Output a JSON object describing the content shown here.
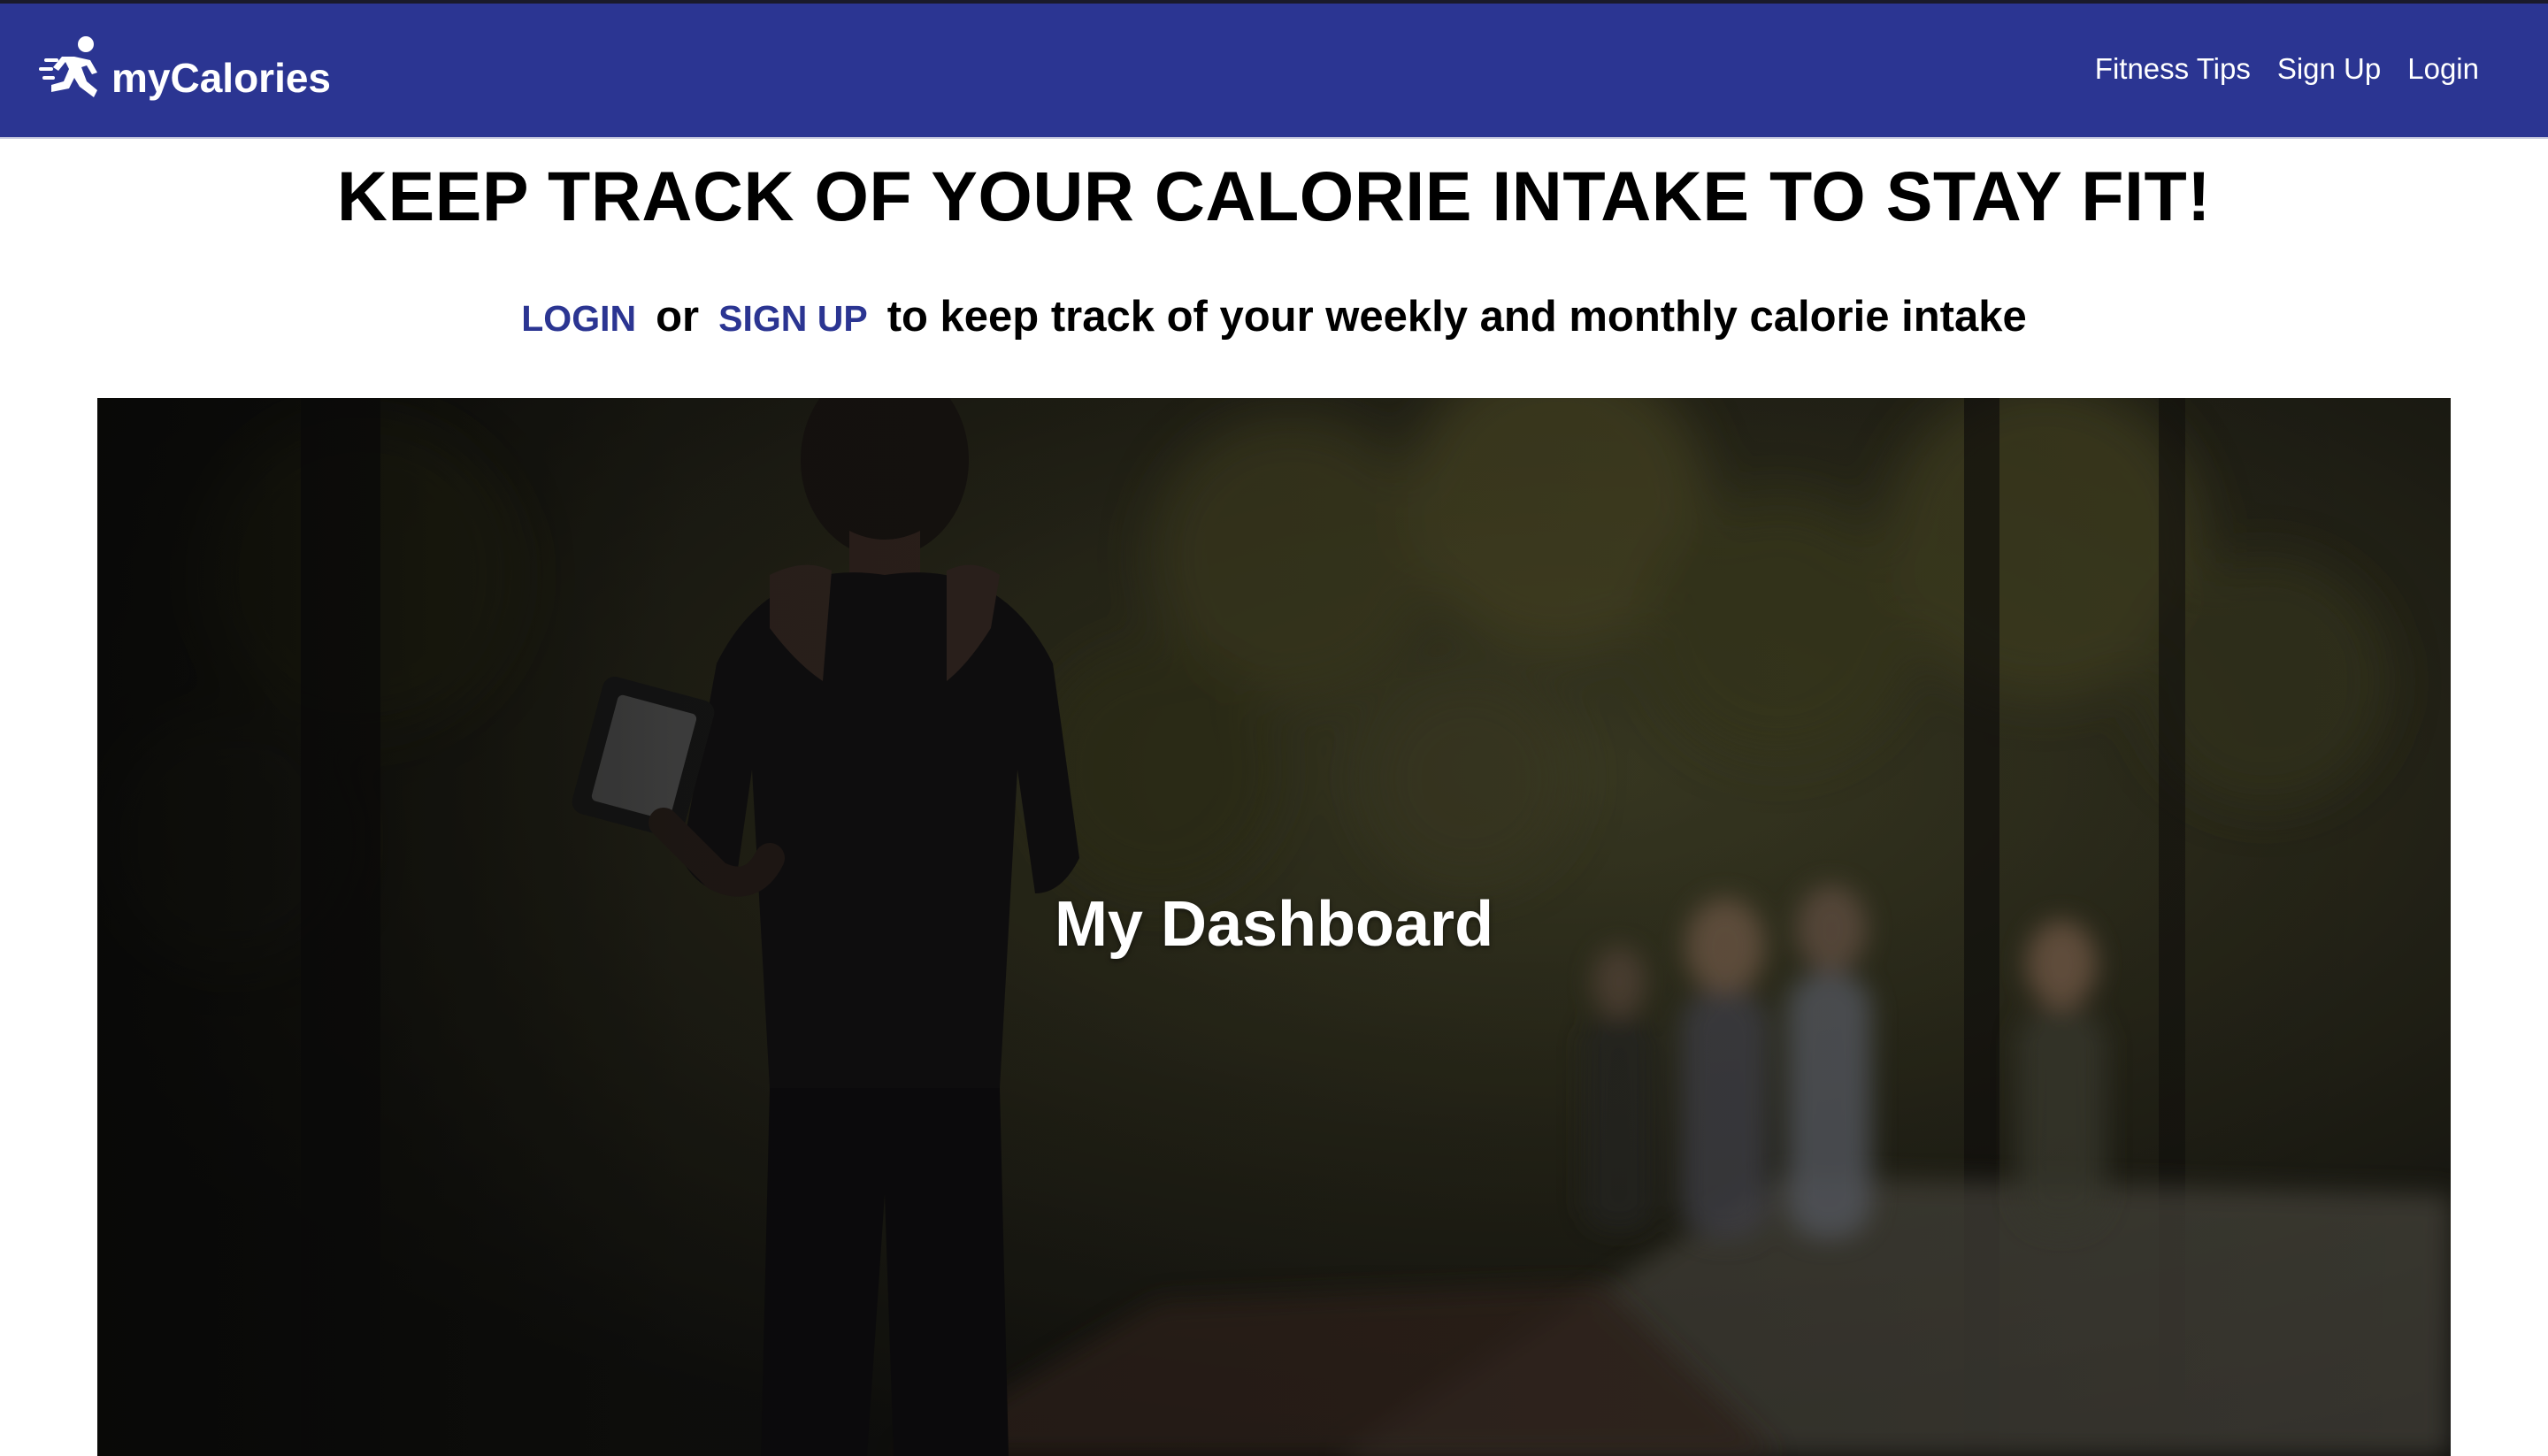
{
  "navbar": {
    "brand_icon": "runner-icon",
    "brand_name": "myCalories",
    "links": [
      "Fitness Tips",
      "Sign Up",
      "Login"
    ],
    "background": "#2b3592"
  },
  "headline": "KEEP TRACK OF YOUR CALORIE INTAKE TO STAY FIT!",
  "subline": {
    "login_label": "LOGIN",
    "or_text": "or",
    "signup_label": "SIGN UP",
    "rest_text": "to keep track of your weekly and monthly calorie intake"
  },
  "hero": {
    "title": "My Dashboard",
    "image": "woman-jogging-photo"
  }
}
